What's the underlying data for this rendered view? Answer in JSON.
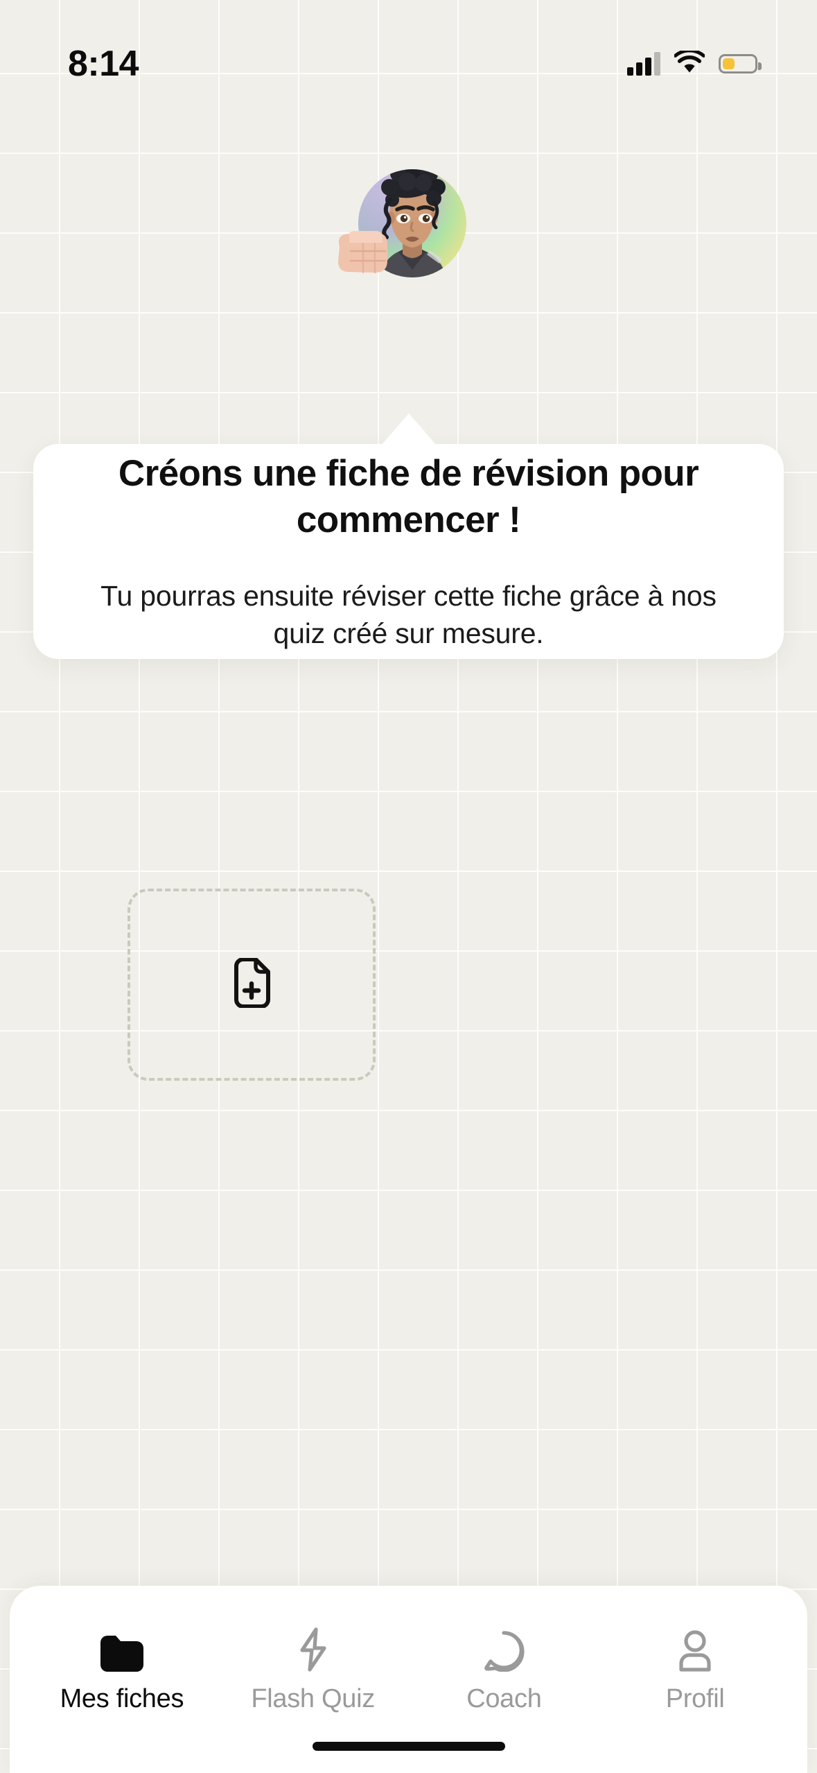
{
  "status_bar": {
    "time": "8:14",
    "cellular_icon": "cellular-bars-icon",
    "wifi_icon": "wifi-icon",
    "battery_icon": "battery-low-icon",
    "battery_color": "#f5c339"
  },
  "avatar": {
    "icon": "coach-avatar-fist-bump",
    "gradient_purple": "#b49bf0",
    "gradient_green": "#91e09a",
    "gradient_yellow": "#f0df7e",
    "skin": "#c99878",
    "hair": "#23232a",
    "shirt": "#4a4a50"
  },
  "coach_card": {
    "title": "Créons une fiche de révision pour commencer !",
    "subtitle": "Tu pourras ensuite réviser cette fiche grâce à nos quiz créé sur mesure.",
    "background": "#ffffff",
    "pointer_icon": "speech-pointer-triangle"
  },
  "dropzone": {
    "icon": "file-plus-icon",
    "border_color": "#c9cabd",
    "icon_color": "#121212"
  },
  "bottom_nav": {
    "items": [
      {
        "label": "Mes fiches",
        "icon": "folder-icon",
        "state": "active"
      },
      {
        "label": "Flash Quiz",
        "icon": "lightning-bolt-icon",
        "state": "inactive"
      },
      {
        "label": "Coach",
        "icon": "speech-bubble-icon",
        "state": "inactive"
      },
      {
        "label": "Profil",
        "icon": "person-icon",
        "state": "inactive"
      }
    ],
    "active_color": "#0c0c0c",
    "inactive_color": "#9a9a9a",
    "home_indicator": "home-indicator-bar"
  },
  "theme": {
    "page_background": "#f0efe9",
    "grid_line": "#ffffff",
    "card_background": "#ffffff",
    "text_primary": "#101010"
  }
}
